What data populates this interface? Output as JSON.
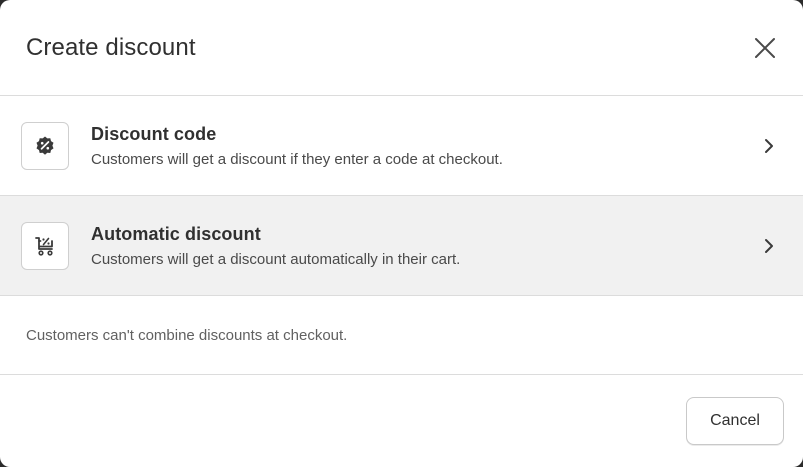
{
  "modal": {
    "title": "Create discount",
    "close_icon": "close-icon"
  },
  "options": [
    {
      "title": "Discount code",
      "description": "Customers will get a discount if they enter a code at checkout.",
      "icon": "discount-badge-icon",
      "hovered": false
    },
    {
      "title": "Automatic discount",
      "description": "Customers will get a discount automatically in their cart.",
      "icon": "cart-discount-icon",
      "hovered": true
    }
  ],
  "note": "Customers can't combine discounts at checkout.",
  "footer": {
    "cancel_label": "Cancel"
  },
  "colors": {
    "hover_background": "#f1f1f1",
    "border": "#dcdcdc",
    "text_primary": "#303030"
  }
}
